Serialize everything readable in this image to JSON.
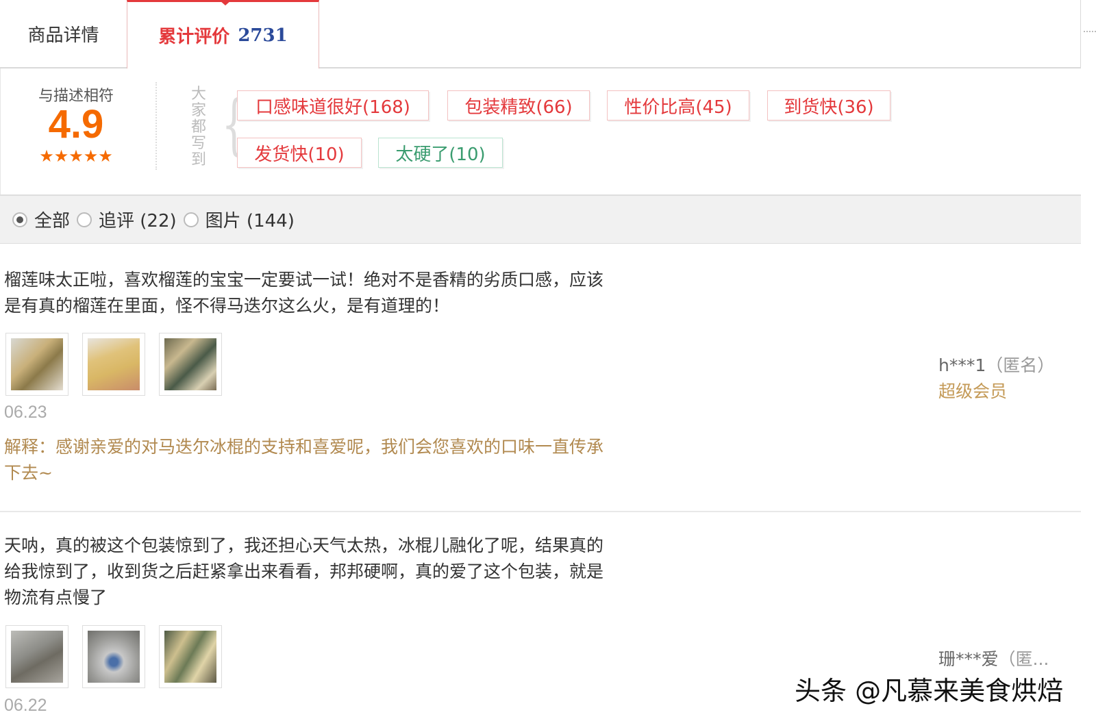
{
  "tabs": {
    "detail_label": "商品详情",
    "reviews_label": "累计评价",
    "reviews_count": "2731"
  },
  "rating": {
    "label": "与描述相符",
    "score": "4.9",
    "stars": "★★★★★"
  },
  "tags_header": "大家都写到",
  "tags": [
    {
      "label": "口感味道很好(168)",
      "sentiment": "positive"
    },
    {
      "label": "包装精致(66)",
      "sentiment": "positive"
    },
    {
      "label": "性价比高(45)",
      "sentiment": "positive"
    },
    {
      "label": "到货快(36)",
      "sentiment": "positive"
    },
    {
      "label": "发货快(10)",
      "sentiment": "positive"
    },
    {
      "label": "太硬了(10)",
      "sentiment": "negative"
    }
  ],
  "filters": [
    {
      "label": "全部",
      "checked": true
    },
    {
      "label": "追评 (22)",
      "checked": false
    },
    {
      "label": "图片 (144)",
      "checked": false
    }
  ],
  "reviews": [
    {
      "text_line1": "榴莲味太正啦，喜欢榴莲的宝宝一定要试一试！绝对不是香精的劣质口感，应该",
      "text_line2": "是有真的榴莲在里面，怪不得马迭尔这么火，是有道理的！",
      "date": "06.23",
      "reply_line1": "解释：感谢亲爱的对马迭尔冰棍的支持和喜爱呢，我们会您喜欢的口味一直传承",
      "reply_line2": "下去~",
      "user": "h***1",
      "anon": "（匿名）",
      "member": "超级会员"
    },
    {
      "text_line1": "天呐，真的被这个包装惊到了，我还担心天气太热，冰棍儿融化了呢，结果真的",
      "text_line2": "给我惊到了，收到货之后赶紧拿出来看看，邦邦硬啊，真的爱了这个包装，就是",
      "text_line3": "物流有点慢了",
      "date": "06.22",
      "user": "珊***爱",
      "anon": "（匿..."
    }
  ],
  "watermark": "头条 @凡慕来美食烘焙",
  "colors": {
    "accent": "#e4393c",
    "score": "#f56a00",
    "reply": "#b1894f",
    "negative_tag": "#3a9c6f"
  }
}
